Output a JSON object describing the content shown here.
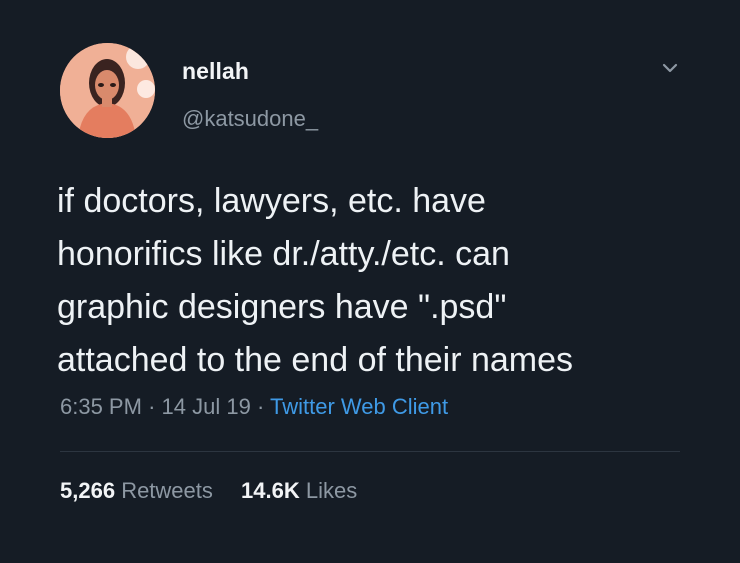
{
  "user": {
    "display_name": "nellah",
    "handle": "@katsudone_"
  },
  "tweet": {
    "text_lines": [
      "if doctors, lawyers, etc. have",
      "honorifics like dr./atty./etc. can",
      "graphic designers have \".psd\"",
      "attached to the end of their names"
    ],
    "time": "6:35 PM",
    "date": "14 Jul 19",
    "separator": "·",
    "source": "Twitter Web Client"
  },
  "stats": {
    "retweets_count": "5,266",
    "retweets_label": "Retweets",
    "likes_count": "14.6K",
    "likes_label": "Likes"
  },
  "icons": {
    "menu": "chevron-down-icon"
  },
  "colors": {
    "background": "#151c25",
    "primary_text": "#eef2f5",
    "secondary_text": "#8d98a3",
    "link": "#3f9ae6",
    "divider": "#2c3540"
  }
}
